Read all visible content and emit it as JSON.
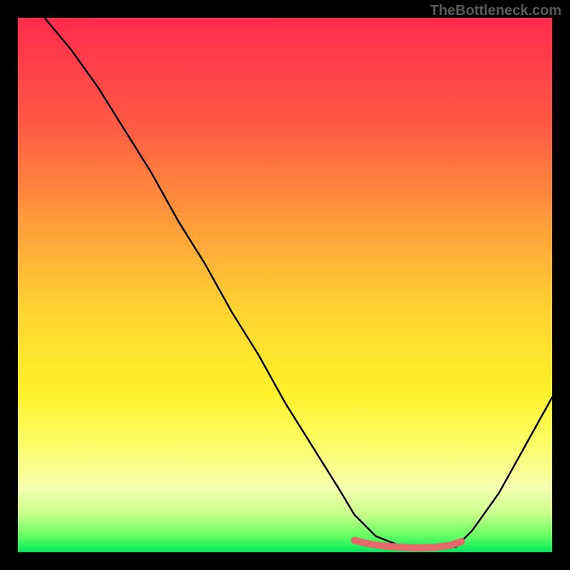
{
  "watermark": "TheBottleneck.com",
  "chart_data": {
    "type": "line",
    "title": "",
    "xlabel": "",
    "ylabel": "",
    "xlim": [
      0,
      100
    ],
    "ylim": [
      0,
      100
    ],
    "series": [
      {
        "name": "main-curve",
        "color": "#000000",
        "x": [
          5,
          10,
          15,
          20,
          25,
          30,
          35,
          40,
          45,
          50,
          55,
          60,
          63,
          67,
          72,
          77,
          82,
          85,
          90,
          95,
          100
        ],
        "values": [
          100,
          94,
          87,
          79,
          71,
          62,
          54,
          45,
          37,
          28,
          20,
          12,
          7,
          3,
          1,
          0.5,
          1,
          4,
          11,
          20,
          29
        ]
      },
      {
        "name": "bottom-marker",
        "color": "#e26a6a",
        "x": [
          63,
          66,
          69,
          72,
          75,
          78,
          81,
          83
        ],
        "values": [
          2.2,
          1.5,
          1.1,
          0.9,
          0.8,
          0.9,
          1.3,
          2.0
        ]
      }
    ],
    "gradient_stops": [
      {
        "pct": 0,
        "color": "#ff2b4d"
      },
      {
        "pct": 20,
        "color": "#ff5a44"
      },
      {
        "pct": 40,
        "color": "#ffa23a"
      },
      {
        "pct": 55,
        "color": "#ffd531"
      },
      {
        "pct": 70,
        "color": "#fff12a"
      },
      {
        "pct": 80,
        "color": "#fdfd68"
      },
      {
        "pct": 88,
        "color": "#f6ffb0"
      },
      {
        "pct": 93,
        "color": "#c6ff8a"
      },
      {
        "pct": 97,
        "color": "#63ff63"
      },
      {
        "pct": 100,
        "color": "#00e85b"
      }
    ]
  }
}
